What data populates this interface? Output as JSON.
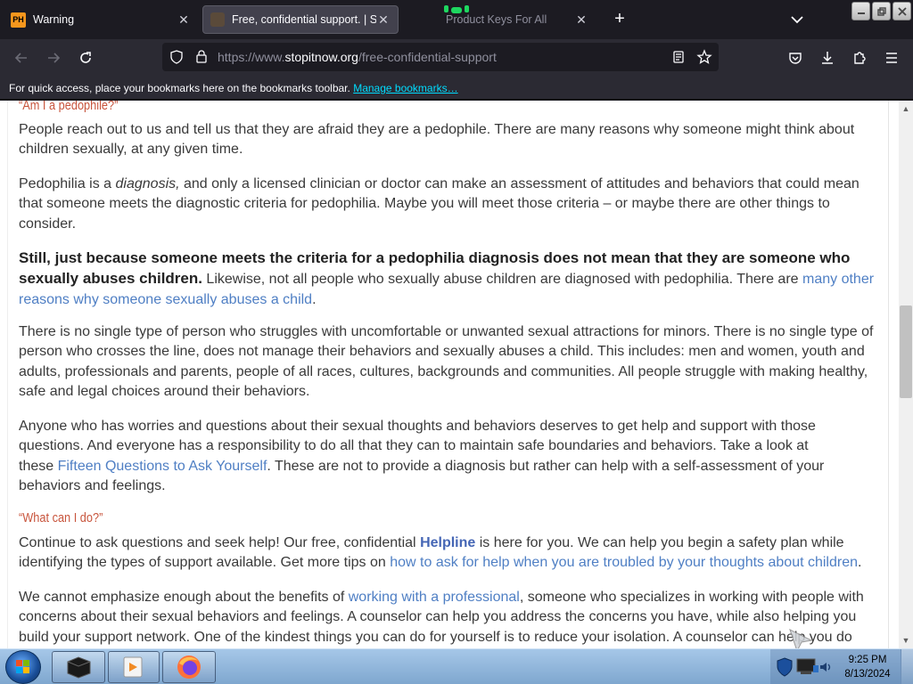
{
  "browser": {
    "tabs": [
      {
        "title": "Warning",
        "favicon": "PH",
        "active": false
      },
      {
        "title": "Free, confidential support. | Stop It Now",
        "active": true
      },
      {
        "title": "Product Keys For All",
        "active": false
      }
    ],
    "url": {
      "scheme": "https://www.",
      "domain": "stopitnow.org",
      "path": "/free-confidential-support"
    },
    "bookmarks_bar": {
      "message": "For quick access, place your bookmarks here on the bookmarks toolbar.",
      "link": "Manage bookmarks…"
    }
  },
  "page": {
    "heading1": "“Am I a pedophile?”",
    "p1": "People reach out to us and tell us that they are afraid they are a pedophile. There are many reasons why someone might think about children sexually, at any given time.",
    "p2": {
      "a": "Pedophilia is a ",
      "em": "diagnosis,",
      "b": " and only a licensed clinician or doctor can make an assessment of attitudes and behaviors that could mean that someone meets the diagnostic criteria for pedophilia. Maybe you will meet those criteria – or maybe there are other things to consider."
    },
    "p3": {
      "bold": "Still, just because someone meets the criteria for a pedophilia diagnosis does not mean that they are someone who sexually abuses children.",
      "text": " Likewise, not all people who sexually abuse children are diagnosed with pedophilia. There are ",
      "link": "many other reasons why someone sexually abuses a child",
      "end": "."
    },
    "p4": "There is no single type of person who struggles with uncomfortable or unwanted sexual attractions for minors. There is no single type of person who crosses the line, does not manage their behaviors and sexually abuses a child. This includes: men and women, youth and adults, professionals and parents, people of all races, cultures, backgrounds and communities. All people struggle with making healthy, safe and legal choices around their behaviors.",
    "p5": {
      "a": "Anyone who has worries and questions about their sexual thoughts and behaviors deserves to get help and support with those questions. And everyone has a responsibility to do all that they can to maintain safe boundaries and behaviors. Take a look at these ",
      "link": "Fifteen Questions to Ask Yourself",
      "b": ". These are not to provide a diagnosis but rather can help with a self-assessment of your behaviors and feelings."
    },
    "heading2": "“What can I do?”",
    "p6": {
      "a": "Continue to ask questions and seek help! Our free, confidential ",
      "link1": "Helpline",
      "b": " is here for you. We can help you begin a safety plan while identifying the types of support available. Get more tips on ",
      "link2": "how to ask for help when you are troubled by your thoughts about children",
      "end": "."
    },
    "p7": {
      "a": "We cannot emphasize enough about the benefits of ",
      "link": "working with a professional",
      "b": ", someone who specializes in working with people with concerns about their sexual behaviors and feelings. A counselor can help you address the concerns you have, while also helping you build your support network. One of the kindest things you can do for yourself is to reduce your isolation. A counselor can help you do"
    }
  },
  "taskbar": {
    "time": "9:25 PM",
    "date": "8/13/2024"
  }
}
